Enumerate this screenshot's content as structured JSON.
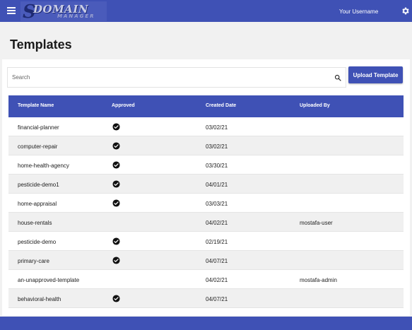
{
  "header": {
    "logo_text": "DOMAIN",
    "logo_subtext": "MANAGER",
    "username": "Your Username"
  },
  "page": {
    "title": "Templates"
  },
  "search": {
    "placeholder": "Search"
  },
  "upload_button": {
    "label": "Upload Template"
  },
  "table": {
    "columns": [
      "Template Name",
      "Approved",
      "Created Date",
      "Uploaded By"
    ],
    "rows": [
      {
        "name": "financial-planner",
        "approved": true,
        "created": "03/02/21",
        "uploaded_by": ""
      },
      {
        "name": "computer-repair",
        "approved": true,
        "created": "03/02/21",
        "uploaded_by": ""
      },
      {
        "name": "home-health-agency",
        "approved": true,
        "created": "03/30/21",
        "uploaded_by": ""
      },
      {
        "name": "pesticide-demo1",
        "approved": true,
        "created": "04/01/21",
        "uploaded_by": ""
      },
      {
        "name": "home-appraisal",
        "approved": true,
        "created": "03/03/21",
        "uploaded_by": ""
      },
      {
        "name": "house-rentals",
        "approved": false,
        "created": "04/02/21",
        "uploaded_by": "mostafa-user"
      },
      {
        "name": "pesticide-demo",
        "approved": true,
        "created": "02/19/21",
        "uploaded_by": ""
      },
      {
        "name": "primary-care",
        "approved": true,
        "created": "04/07/21",
        "uploaded_by": ""
      },
      {
        "name": "an-unapproved-template",
        "approved": false,
        "created": "04/02/21",
        "uploaded_by": "mostafa-admin"
      },
      {
        "name": "behavioral-health",
        "approved": true,
        "created": "04/07/21",
        "uploaded_by": ""
      }
    ]
  },
  "colors": {
    "primary": "#3f51b5",
    "background": "#f1f1f1",
    "row_alt": "#f0f0f0"
  }
}
